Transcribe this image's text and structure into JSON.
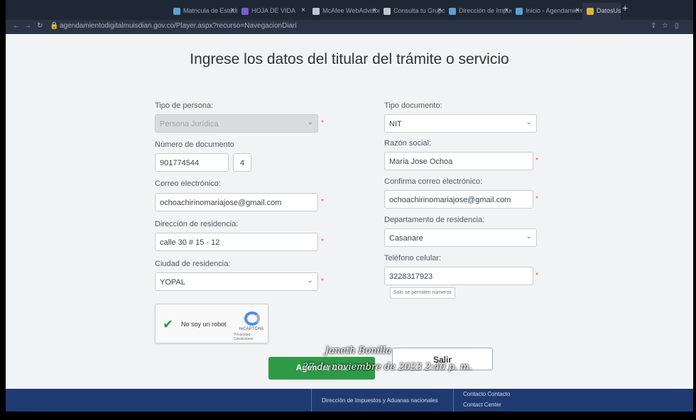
{
  "browser": {
    "tabs": [
      {
        "label": "Matricula de Estudiante"
      },
      {
        "label": "HOJA DE VIDA"
      },
      {
        "label": "McAfee WebAdvisor"
      },
      {
        "label": "Consulta tu Grupo Sis"
      },
      {
        "label": "Dirección de Impuesto"
      },
      {
        "label": "Inicio - Agendamiento"
      },
      {
        "label": "DatosUsuario",
        "active": true
      }
    ],
    "new_tab": "+",
    "url": "agendamientodigitalmuisdian.gov.co/Player.aspx?recurso=NavegacionDiari"
  },
  "page": {
    "title": "Ingrese los datos del titular del trámite o servicio",
    "form": {
      "tipo_persona": {
        "label": "Tipo de persona:",
        "value": "Persona Jurídica"
      },
      "tipo_documento": {
        "label": "Tipo documento:",
        "value": "NIT"
      },
      "numero_documento": {
        "label": "Número de documento",
        "value": "901774544",
        "dv": "4"
      },
      "razon_social": {
        "label": "Razón social:",
        "value": "Maria Jose Ochoa"
      },
      "correo": {
        "label": "Correo electrónico:",
        "value": "ochoachirinomariajose@gmail.com"
      },
      "confirma_correo": {
        "label": "Confirma correo electrónico:",
        "value": "ochoachirinomariajose@gmail.com"
      },
      "direccion": {
        "label": "Dirección de residencia:",
        "value": "calle 30 # 15 - 12"
      },
      "departamento": {
        "label": "Departamento de residencia:",
        "value": "Casanare"
      },
      "ciudad": {
        "label": "Ciudad de residencia:",
        "value": "YOPAL"
      },
      "telefono": {
        "label": "Teléfono celular:",
        "value": "3228317923",
        "hint": "Solo se permiten números"
      },
      "required_mark": "*"
    },
    "captcha": {
      "label": "No soy un robot",
      "brand": "reCAPTCHA",
      "terms": "Privacidad - Condiciones"
    },
    "buttons": {
      "primary": "Agendar cita",
      "secondary": "Salir"
    },
    "footer": {
      "left": "Dirección de Impuestos y Aduanas nacionales",
      "right_title": "Contacto Contacto",
      "right_sub": "Contact Center"
    }
  },
  "watermark": {
    "name": "Janeth Bonilla",
    "date": "27 de noviembre de 2023 2:40 p. m."
  }
}
